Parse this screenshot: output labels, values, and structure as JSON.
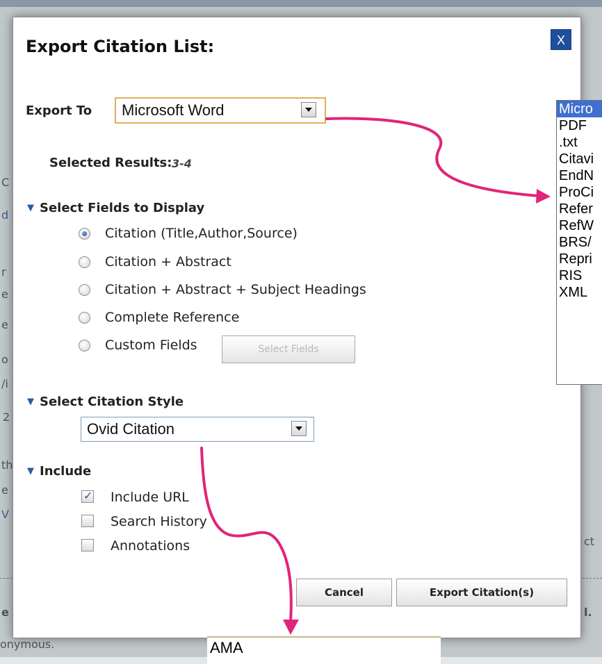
{
  "background": {
    "fragments": [
      "r",
      "e",
      "e",
      "o",
      "/i",
      "2",
      "th",
      "e",
      "V",
      "d",
      "C",
      "ct",
      "e",
      "l.",
      "onymous."
    ]
  },
  "dialog": {
    "title": "Export Citation List:",
    "close_label": "X",
    "export_to": {
      "label": "Export To",
      "value": "Microsoft Word"
    },
    "selected_results": {
      "label": "Selected Results:",
      "value": "3-4"
    },
    "fields_section": {
      "heading": "Select Fields to Display",
      "options": [
        {
          "label": "Citation (Title,Author,Source)",
          "checked": true
        },
        {
          "label": "Citation + Abstract",
          "checked": false
        },
        {
          "label": "Citation + Abstract + Subject Headings",
          "checked": false
        },
        {
          "label": "Complete Reference",
          "checked": false
        },
        {
          "label": "Custom Fields",
          "checked": false
        }
      ],
      "select_fields_button": "Select Fields"
    },
    "style_section": {
      "heading": "Select Citation Style",
      "value": "Ovid Citation"
    },
    "include_section": {
      "heading": "Include",
      "options": [
        {
          "label": "Include URL",
          "checked": true
        },
        {
          "label": "Search History",
          "checked": false
        },
        {
          "label": "Annotations",
          "checked": false
        }
      ]
    },
    "buttons": {
      "cancel": "Cancel",
      "export": "Export Citation(s)"
    }
  },
  "export_options": {
    "selected_index": 0,
    "items": [
      "Micro",
      "PDF",
      ".txt",
      "Citavi",
      "EndN",
      "ProCi",
      "Refer",
      "RefW",
      "BRS/",
      "Repri",
      "RIS",
      "XML"
    ]
  },
  "citation_options": {
    "items": [
      "AMA"
    ]
  },
  "colors": {
    "accent": "#1f4f9c",
    "arrow": "#e0257a",
    "highlight": "#3f6fcf"
  }
}
